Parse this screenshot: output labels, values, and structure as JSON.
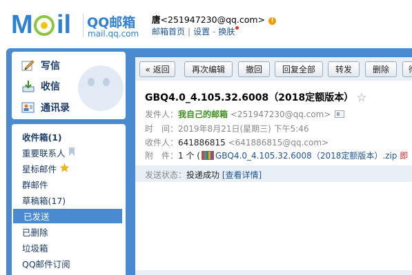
{
  "logo": {
    "letters_left": "M",
    "letters_right": "il",
    "title_cn": "QQ邮箱",
    "url": "mail.qq.com"
  },
  "user": {
    "name": "唐",
    "email": "<251947230@qq.com>",
    "badge": "!",
    "links": [
      "邮箱首页",
      "设置",
      "换肤"
    ],
    "sep": "|",
    "sep2": "-"
  },
  "compose": [
    {
      "label": "写信",
      "icon": "pencil-icon"
    },
    {
      "label": "收信",
      "icon": "inbox-download-icon"
    },
    {
      "label": "通讯录",
      "icon": "contacts-icon"
    }
  ],
  "folders": [
    {
      "label": "收件箱(1)",
      "bold": true
    },
    {
      "label": "重要联系人",
      "icon": "bookmark-icon"
    },
    {
      "label": "星标邮件",
      "icon": "star-icon"
    },
    {
      "label": "群邮件"
    },
    {
      "label": "草稿箱(17)"
    },
    {
      "label": "已发送",
      "active": true
    },
    {
      "label": "已删除"
    },
    {
      "label": "垃圾箱"
    },
    {
      "label": "QQ邮件订阅"
    }
  ],
  "toolbar": {
    "back": "« 返回",
    "reedit": "再次编辑",
    "recall": "撤回",
    "reply_all": "回复全部",
    "forward": "转发",
    "delete": "删除",
    "more": "彻"
  },
  "mail": {
    "subject": "GBQ4.0_4.105.32.6008（2018定额版本）",
    "star": "☆",
    "from_label": "发件人：",
    "from_name": "我自己的邮箱",
    "from_email": "<251947230@qq.com>",
    "time_label": "时　间：",
    "time_value": "2019年8月21日(星期三) 下午5:46",
    "to_label": "收件人：",
    "to_name": "641886815",
    "to_email": "<641886815@qq.com>",
    "attach_label": "附　件：",
    "attach_count": "1 个 (",
    "attach_name": "GBQ4.0_4.105.32.6008（2018定额版本）.zip",
    "attach_trail": "即",
    "status_label": "发送状态：",
    "status_value": "投递成功",
    "status_link": "[查看详情]"
  },
  "colors": {
    "frame": "#4a8ad0",
    "link": "#1e5494",
    "green": "#3f8f1f",
    "badge": "#f29b00"
  }
}
